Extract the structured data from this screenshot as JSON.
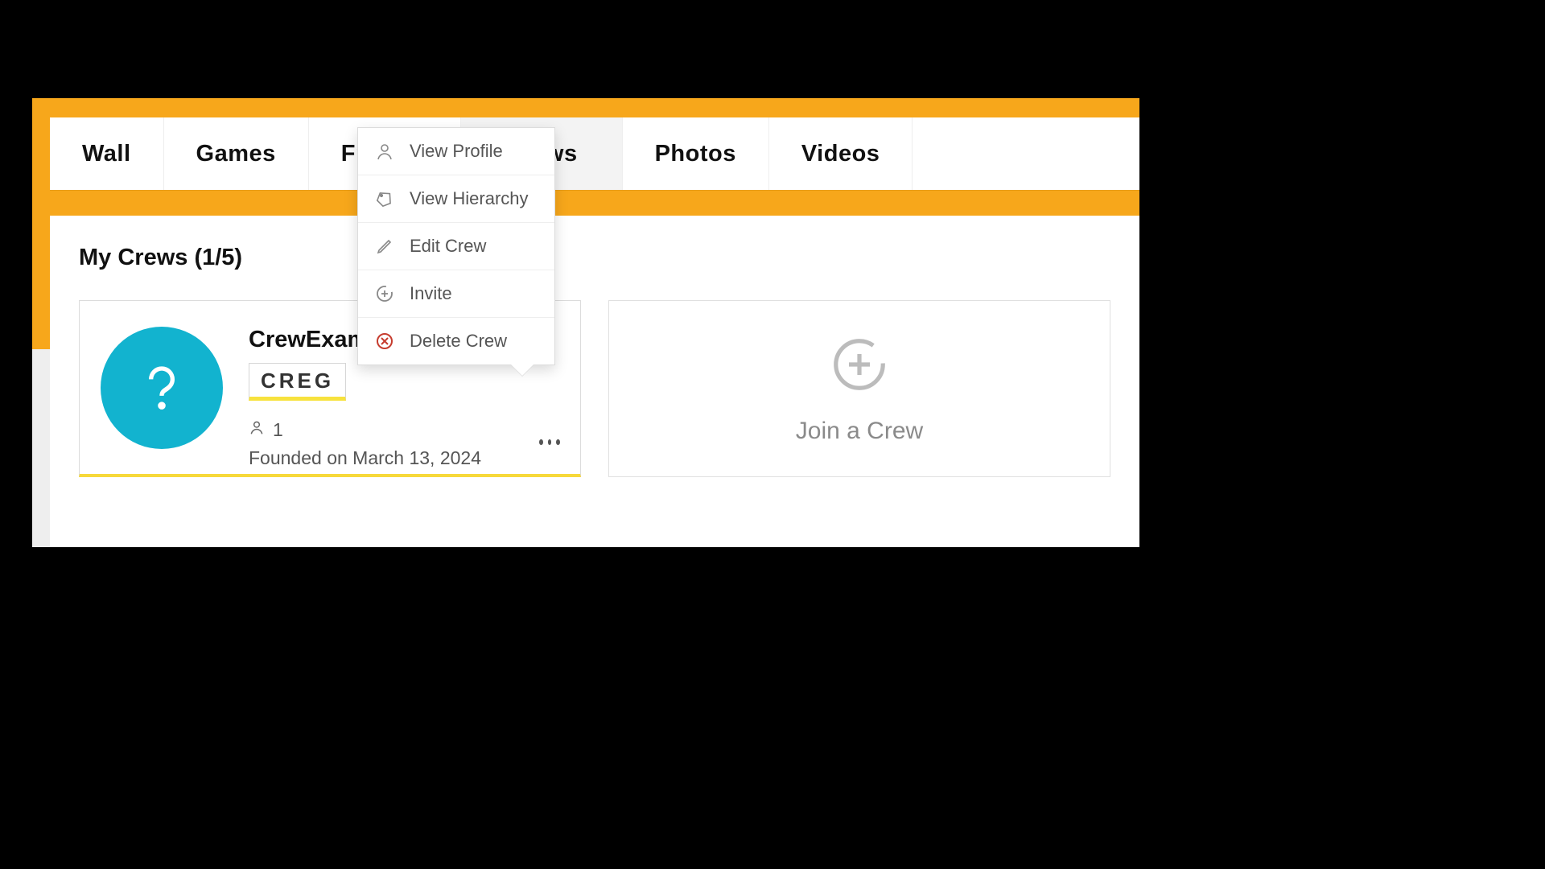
{
  "tabs": {
    "wall": "Wall",
    "games": "Games",
    "friends": "Friends",
    "crews": "Crews",
    "photos": "Photos",
    "videos": "Videos"
  },
  "section": {
    "title": "My Crews (1/5)"
  },
  "crew": {
    "name": "CrewExamp",
    "tag": "CREG",
    "member_count": "1",
    "founded": "Founded on March 13, 2024"
  },
  "join": {
    "label": "Join a Crew"
  },
  "menu": {
    "view_profile": "View Profile",
    "view_hierarchy": "View Hierarchy",
    "edit_crew": "Edit Crew",
    "invite": "Invite",
    "delete_crew": "Delete Crew"
  }
}
